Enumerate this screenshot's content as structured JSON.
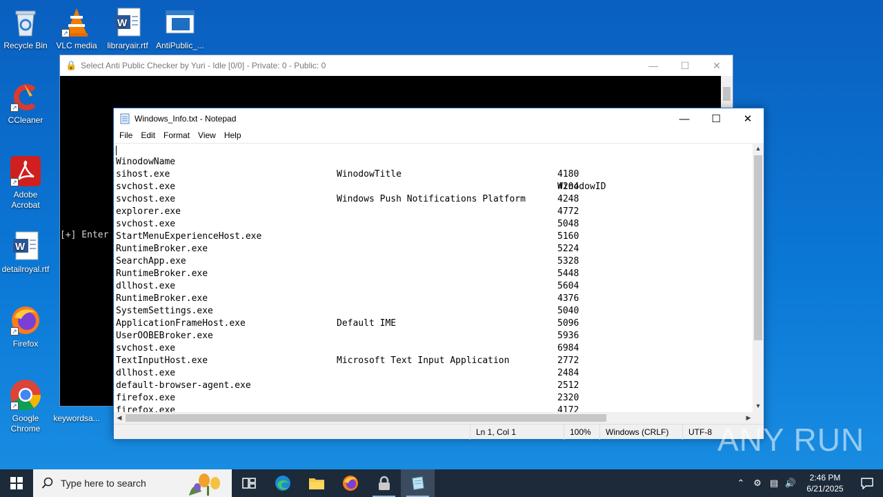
{
  "desktop": {
    "icons": [
      {
        "label": "Recycle Bin",
        "icon": "recycle-bin-icon"
      },
      {
        "label": "VLC media",
        "icon": "vlc-icon"
      },
      {
        "label": "libraryair.rtf",
        "icon": "word-document-icon"
      },
      {
        "label": "AntiPublic_...",
        "icon": "application-window-icon"
      },
      {
        "label": "CCleaner",
        "icon": "ccleaner-icon"
      },
      {
        "label": "Adobe Acrobat",
        "icon": "adobe-acrobat-icon"
      },
      {
        "label": "detailroyal.rtf",
        "icon": "word-document-icon"
      },
      {
        "label": "Firefox",
        "icon": "firefox-icon"
      },
      {
        "label": "Google Chrome",
        "icon": "chrome-icon"
      },
      {
        "label": "keywordsa...",
        "icon": "document-icon"
      }
    ],
    "partial_labels": [
      "cc",
      "h",
      "w"
    ]
  },
  "console": {
    "title": "Select Anti Public Checker by Yuri - Idle [0/0] - Private: 0 - Public: 0",
    "prompt": "[+] Enter"
  },
  "notepad": {
    "title": "Windows_Info.txt - Notepad",
    "menu": [
      "File",
      "Edit",
      "Format",
      "View",
      "Help"
    ],
    "headers": [
      "WinodowName",
      "WinodowTitle",
      "WinodowID"
    ],
    "rows": [
      {
        "name": "sihost.exe",
        "title": "",
        "id": "4180"
      },
      {
        "name": "svchost.exe",
        "title": "",
        "id": "4204"
      },
      {
        "name": "svchost.exe",
        "title": "Windows Push Notifications Platform",
        "id": "4248"
      },
      {
        "name": "explorer.exe",
        "title": "",
        "id": "4772"
      },
      {
        "name": "svchost.exe",
        "title": "",
        "id": "5048"
      },
      {
        "name": "StartMenuExperienceHost.exe",
        "title": "",
        "id": "5160"
      },
      {
        "name": "RuntimeBroker.exe",
        "title": "",
        "id": "5224"
      },
      {
        "name": "SearchApp.exe",
        "title": "",
        "id": "5328"
      },
      {
        "name": "RuntimeBroker.exe",
        "title": "",
        "id": "5448"
      },
      {
        "name": "dllhost.exe",
        "title": "",
        "id": "5604"
      },
      {
        "name": "RuntimeBroker.exe",
        "title": "",
        "id": "4376"
      },
      {
        "name": "SystemSettings.exe",
        "title": "",
        "id": "5040"
      },
      {
        "name": "ApplicationFrameHost.exe",
        "title": "Default IME",
        "id": "5096"
      },
      {
        "name": "UserOOBEBroker.exe",
        "title": "",
        "id": "5936"
      },
      {
        "name": "svchost.exe",
        "title": "",
        "id": "6984"
      },
      {
        "name": "TextInputHost.exe",
        "title": "Microsoft Text Input Application",
        "id": "2772"
      },
      {
        "name": "dllhost.exe",
        "title": "",
        "id": "2484"
      },
      {
        "name": "default-browser-agent.exe",
        "title": "",
        "id": "2512"
      },
      {
        "name": "firefox.exe",
        "title": "",
        "id": "2320"
      },
      {
        "name": "firefox.exe",
        "title": "",
        "id": "4172"
      }
    ],
    "status": {
      "position": "Ln 1, Col 1",
      "zoom": "100%",
      "line_ending": "Windows (CRLF)",
      "encoding": "UTF-8"
    }
  },
  "watermark": "ANY RUN",
  "taskbar": {
    "search_placeholder": "Type here to search",
    "apps": [
      "task-view-icon",
      "edge-icon",
      "file-explorer-icon",
      "firefox-icon",
      "lock-app-icon",
      "notepad-icon"
    ],
    "clock_time": "2:46 PM",
    "clock_date": "6/21/2025"
  },
  "colors": {
    "desktop_blue": "#0b78d6",
    "taskbar": "#1c2a3a",
    "notepad_border": "#1b6fc4"
  }
}
